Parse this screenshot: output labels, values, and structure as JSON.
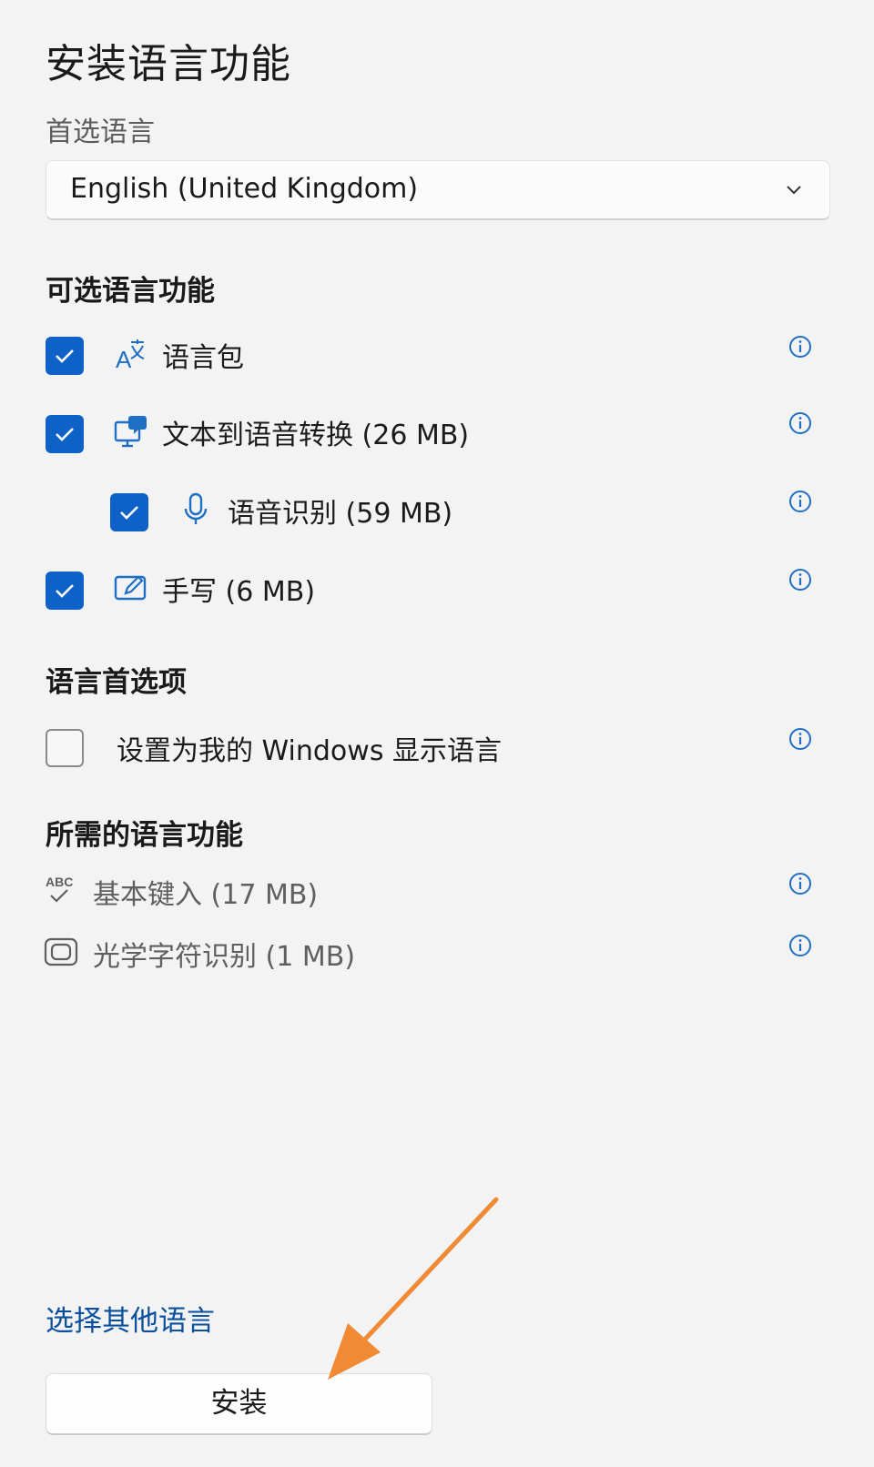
{
  "dialog": {
    "title": "安装语言功能",
    "preferred_language_label": "首选语言",
    "preferred_language_value": "English (United Kingdom)"
  },
  "optional_features": {
    "heading": "可选语言功能",
    "items": [
      {
        "label": "语言包",
        "checked": true,
        "icon": "language-pack-icon"
      },
      {
        "label": "文本到语音转换 (26 MB)",
        "checked": true,
        "icon": "text-to-speech-icon"
      },
      {
        "label": "语音识别 (59 MB)",
        "checked": true,
        "icon": "microphone-icon"
      },
      {
        "label": "手写 (6 MB)",
        "checked": true,
        "icon": "handwriting-icon"
      }
    ]
  },
  "language_preferences": {
    "heading": "语言首选项",
    "display_language_label": "设置为我的 Windows 显示语言",
    "display_language_checked": false
  },
  "required_features": {
    "heading": "所需的语言功能",
    "items": [
      {
        "label": "基本键入 (17 MB)",
        "icon": "basic-typing-icon"
      },
      {
        "label": "光学字符识别 (1 MB)",
        "icon": "ocr-icon"
      }
    ]
  },
  "footer": {
    "choose_other_language": "选择其他语言",
    "install_label": "安装"
  },
  "colors": {
    "accent": "#0e62c7",
    "link": "#0a4f9e",
    "annotation_arrow": "#f08a35"
  }
}
